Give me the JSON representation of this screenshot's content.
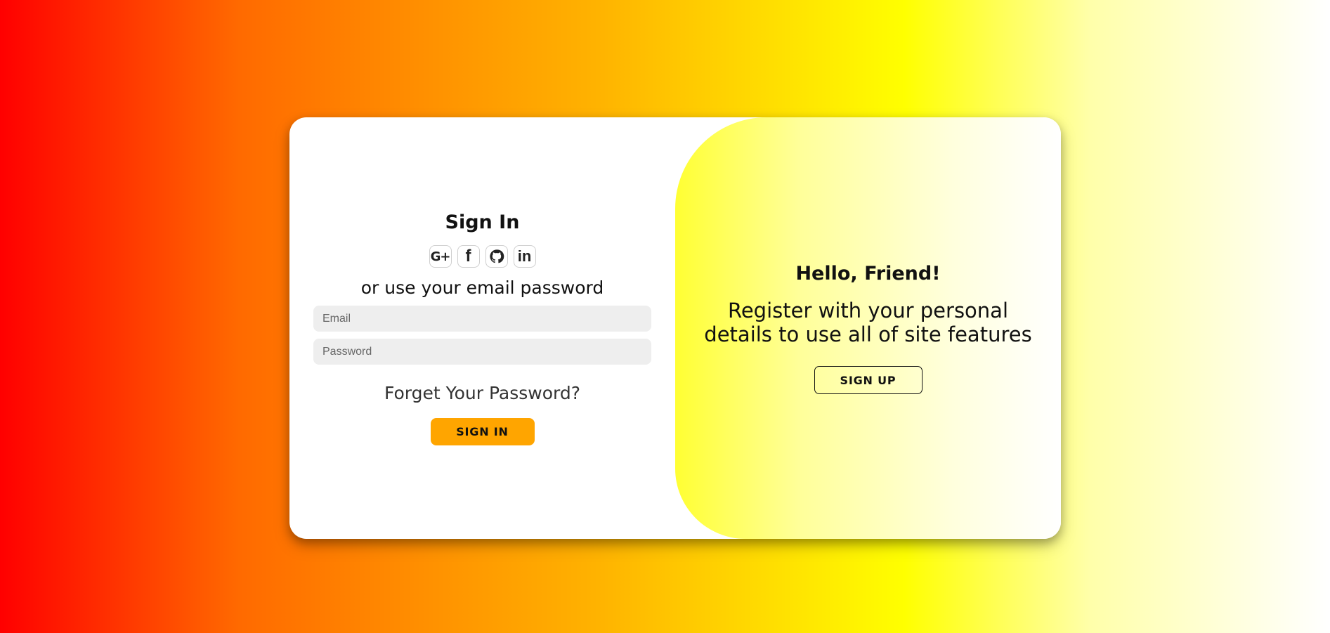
{
  "signin": {
    "title": "Sign In",
    "social_buttons": {
      "google": "google-icon",
      "facebook": "facebook-icon",
      "github": "github-icon",
      "linkedin": "linkedin-icon"
    },
    "divider_text": "or use your email password",
    "email_placeholder": "Email",
    "password_placeholder": "Password",
    "forgot_text": "Forget Your Password?",
    "button_label": "SIGN IN"
  },
  "toggle": {
    "title": "Hello, Friend!",
    "text": "Register with your personal details to use all of site features",
    "button_label": "SIGN UP"
  },
  "colors": {
    "primary_button": "#ffa500",
    "background_gradient": [
      "#ff0000",
      "#ffb300",
      "#ffff00",
      "#ffffff"
    ],
    "toggle_gradient": [
      "#ffff33",
      "#ffffff"
    ]
  }
}
